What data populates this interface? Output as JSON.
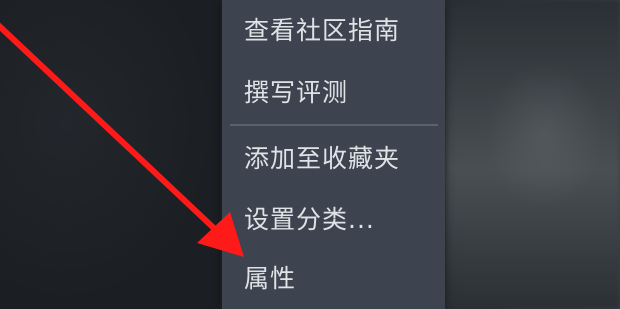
{
  "context_menu": {
    "items": [
      {
        "label": "查看社区指南"
      },
      {
        "label": "撰写评测"
      },
      {
        "label": "添加至收藏夹"
      },
      {
        "label": "设置分类..."
      },
      {
        "label": "属性"
      }
    ]
  },
  "annotation": {
    "arrow_color": "#ff1a1a",
    "points_to": "属性"
  }
}
